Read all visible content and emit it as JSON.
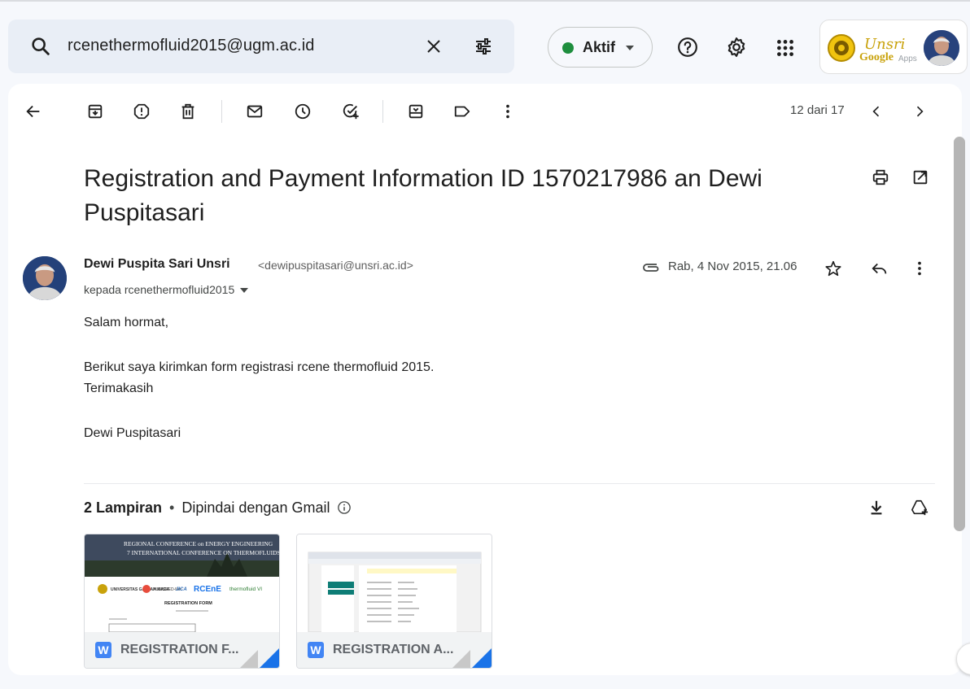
{
  "search": {
    "query": "rcenethermofluid2015@ugm.ac.id",
    "icon": "search-icon"
  },
  "status": {
    "label": "Aktif",
    "color": "#1e8e3e"
  },
  "account": {
    "brand_unsri": "Unsri",
    "brand_google": "Google",
    "brand_apps": "Apps"
  },
  "toolbar": {
    "pager": "12 dari 17"
  },
  "email": {
    "subject": "Registration and Payment Information ID 1570217986 an Dewi Puspitasari",
    "sender_name": "Dewi Puspita Sari Unsri",
    "sender_email": "<dewipuspitasari@unsri.ac.id>",
    "recipient": "kepada rcenethermofluid2015",
    "date": "Rab, 4 Nov 2015, 21.06",
    "body": {
      "greeting": "Salam hormat,",
      "line1": "Berikut saya kirimkan form registrasi rcene thermofluid 2015.",
      "line2": "Terimakasih",
      "signature": "Dewi Puspitasari"
    }
  },
  "attachments": {
    "count_label": "2 Lampiran",
    "scan_label": "Dipindai dengan Gmail",
    "items": [
      {
        "name": "REGISTRATION F...",
        "type_badge": "W",
        "preview_banner_1": "REGIONAL CONFERENCE on ENERGY ENGINEERING",
        "preview_banner_2": "7 INTERNATIONAL CONFERENCE ON THERMOFLUIDS",
        "preview_org_1": "UNIVERSITAS GADJAH MADA",
        "preview_org_2": "AUN/SEED-Net",
        "preview_org_3": "JICA",
        "preview_org_4": "RCEnE",
        "preview_org_5": "thermofluid VI",
        "preview_title": "REGISTRATION FORM"
      },
      {
        "name": "REGISTRATION A...",
        "type_badge": "W"
      }
    ]
  },
  "colors": {
    "accent": "#1a73e8",
    "word_blue": "#4285f4",
    "background": "#f6f8fc"
  }
}
